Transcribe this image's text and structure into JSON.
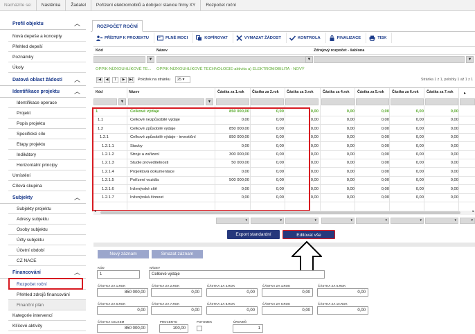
{
  "breadcrumb": {
    "lead": "Nacházíte se:",
    "items": [
      "Nástěnka",
      "Žadatel",
      "Pořízení elektromobilů a dobíjecí stanice firmy XY",
      "Rozpočet roční"
    ]
  },
  "sidebar": {
    "sections": [
      {
        "title": "Profil objektu"
      },
      {
        "title": "Datová oblast žádosti"
      },
      {
        "title": "Identifikace projektu"
      },
      {
        "title": "Subjekty"
      },
      {
        "title": "Financování"
      }
    ],
    "profil_items": [
      "Nová depeše a koncepty",
      "Přehled depeší",
      "Poznámky",
      "Úkoly"
    ],
    "identifikace_items": [
      "Identifikace operace",
      "Projekt",
      "Popis projektu",
      "Specifické cíle",
      "Etapy projektu",
      "Indikátory",
      "Horizontální principy"
    ],
    "mid_items": [
      "Umístění",
      "Cílová skupina"
    ],
    "subjekty_items": [
      "Subjekty projektu",
      "Adresy subjektu",
      "Osoby subjektu",
      "Účty subjektu",
      "Účetní období",
      "CZ NACE"
    ],
    "financovani_items": [
      "Rozpočet roční",
      "Přehled zdrojů financování",
      "Finanční plán"
    ],
    "bottom_items": [
      "Kategorie intervencí",
      "Klíčové aktivity"
    ]
  },
  "tab": {
    "label": "ROZPOČET ROČNÍ"
  },
  "toolbar": [
    {
      "label": "PŘÍSTUP K PROJEKTU",
      "icon": "user-key-icon"
    },
    {
      "label": "PLNÉ MOCI",
      "icon": "card-icon"
    },
    {
      "label": "KOPÍROVAT",
      "icon": "copy-icon"
    },
    {
      "label": "VYMAZAT ŽÁDOST",
      "icon": "x-icon"
    },
    {
      "label": "KONTROLA",
      "icon": "check-icon"
    },
    {
      "label": "FINALIZACE",
      "icon": "lock-icon"
    },
    {
      "label": "TISK",
      "icon": "printer-icon"
    }
  ],
  "top_grid": {
    "headers": {
      "kod": "Kód",
      "nazev": "Název",
      "zdroj": "Zdrojový rozpočet - šablona"
    },
    "row": {
      "kod": "OPPIK-NÍZKOUHLÍKOVÉ TE...",
      "nazev": "OPPIK-NÍZKOUHLÍKOVÉ TECHNOLOGIE-aktivita a) ELEKTROMOBILITA - NOVÝ"
    },
    "pager": {
      "page": "1",
      "per_page_label": "Položek na stránku",
      "per_page": "25",
      "status": "Stránka 1 z 1, položky 1 až 1 z 1"
    }
  },
  "main_grid": {
    "headers": {
      "kod": "Kód",
      "nazev": "Název",
      "years": [
        "Částka za 1.rok",
        "Částka za 2.rok",
        "Částka za 3.rok",
        "Částka za 4.rok",
        "Částka za 5.rok",
        "Částka za 6.rok",
        "Částka za 7.rok"
      ]
    },
    "rows": [
      {
        "kod": "1",
        "nazev": "Celkové výdaje",
        "y1": "850 000,00",
        "y2": "0,00",
        "highlight": true
      },
      {
        "kod": "1.1",
        "nazev": "Celkové nezpůsobilé výdaje",
        "y1": "0,00",
        "y2": "0,00"
      },
      {
        "kod": "1.2",
        "nazev": "Celkové způsobilé výdaje",
        "y1": "850 000,00",
        "y2": "0,00"
      },
      {
        "kod": "1.2.1",
        "nazev": "Celkové způsobilé výdaje - investiční",
        "y1": "850 000,00",
        "y2": "0,00"
      },
      {
        "kod": "1.2.1.1",
        "nazev": "Stavby",
        "y1": "0,00",
        "y2": "0,00"
      },
      {
        "kod": "1.2.1.2",
        "nazev": "Stroje a zařízení",
        "y1": "300 000,00",
        "y2": "0,00"
      },
      {
        "kod": "1.2.1.3",
        "nazev": "Studie proveditelnosti",
        "y1": "50 000,00",
        "y2": "0,00"
      },
      {
        "kod": "1.2.1.4",
        "nazev": "Projektová dokumentace",
        "y1": "0,00",
        "y2": "0,00"
      },
      {
        "kod": "1.2.1.5",
        "nazev": "Pořízení vozidla",
        "y1": "500 000,00",
        "y2": "0,00"
      },
      {
        "kod": "1.2.1.6",
        "nazev": "Inženýrské sítě",
        "y1": "0,00",
        "y2": "0,00"
      },
      {
        "kod": "1.2.1.7",
        "nazev": "Inženýrská činnost",
        "y1": "0,00",
        "y2": "0,00"
      }
    ],
    "other_cols_value": "0,00",
    "footer_zero": "0,00"
  },
  "buttons": {
    "export": "Export standardní",
    "edit_all": "Editovat vše",
    "new_record": "Nový záznam",
    "delete_record": "Smazat záznam"
  },
  "form": {
    "kod_label": "KÓD",
    "kod": "1",
    "nazev_label": "NÁZEV",
    "nazev": "Celkové výdaje",
    "years": [
      {
        "label": "ČÁSTKA ZA 1.ROK",
        "value": "850 000,00"
      },
      {
        "label": "ČÁSTKA ZA 2.ROK",
        "value": "0,00"
      },
      {
        "label": "ČÁSTKA ZA 3.ROK",
        "value": "0,00"
      },
      {
        "label": "ČÁSTKA ZA 4.ROK",
        "value": "0,00"
      },
      {
        "label": "ČÁSTKA ZA 5.ROK",
        "value": "0,00"
      },
      {
        "label": "ČÁSTKA ZA 6.ROK",
        "value": "0,00"
      },
      {
        "label": "ČÁSTKA ZA 7.ROK",
        "value": "0,00"
      },
      {
        "label": "ČÁSTKA ZA 8.ROK",
        "value": "0,00"
      },
      {
        "label": "ČÁSTKA ZA 9.ROK",
        "value": "0,00"
      },
      {
        "label": "ČÁSTKA ZA 10.ROK",
        "value": "0,00"
      }
    ],
    "celkem_label": "ČÁSTKA CELKEM",
    "celkem": "850 000,00",
    "procento_label": "PROCENTO",
    "procento": "100,00",
    "potomek_label": "POTOMEK",
    "uroven_label": "ÚROVEŇ",
    "uroven": "1"
  },
  "colors": {
    "accent": "#26387c",
    "highlight_text": "#57a82a",
    "red_box": "#d71a21"
  }
}
